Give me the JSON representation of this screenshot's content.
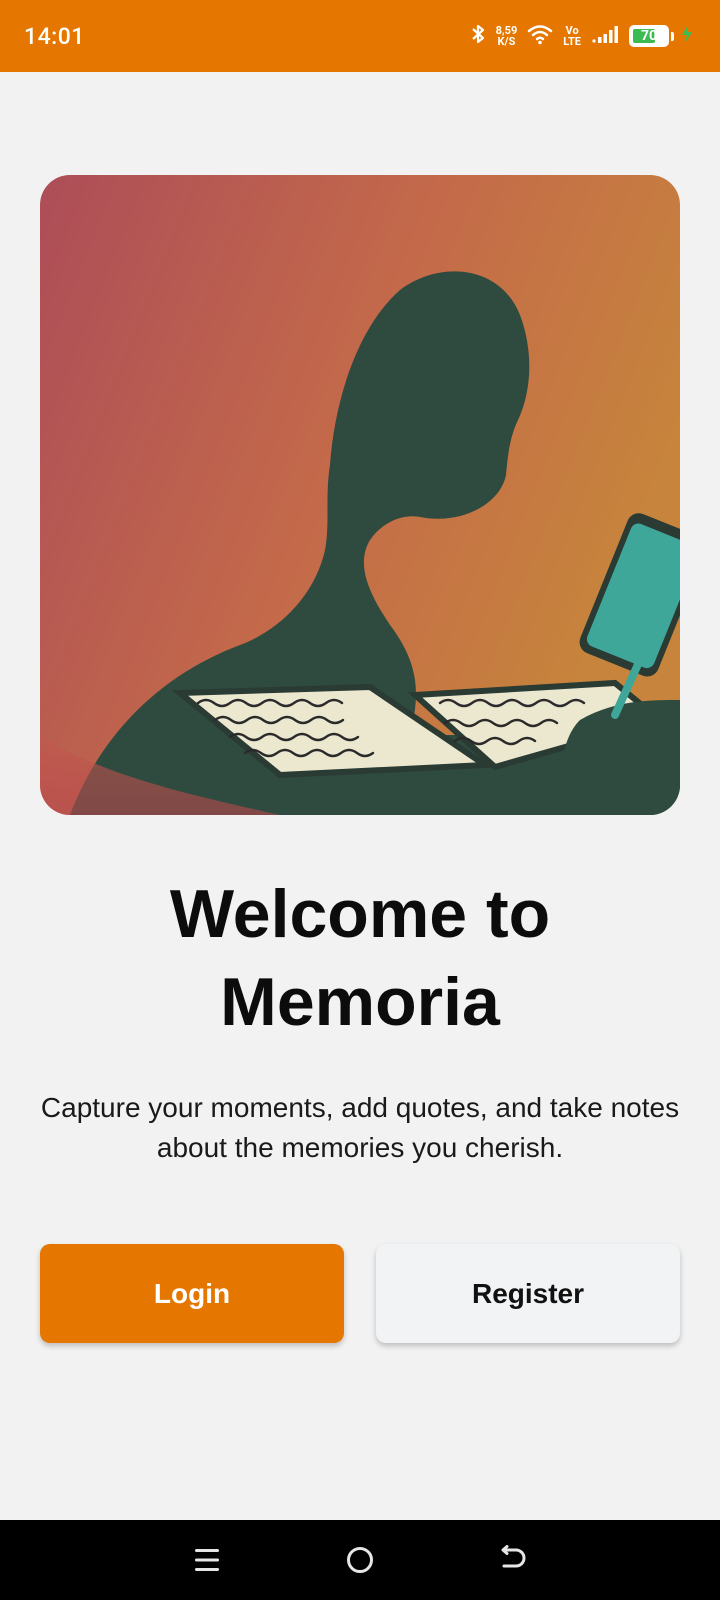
{
  "status_bar": {
    "time": "14:01",
    "net_speed_value": "8,59",
    "net_speed_unit": "K/S",
    "volte_top": "Vo",
    "volte_bottom": "LTE",
    "battery_level": "70",
    "battery_level_fraction": 0.7,
    "bg_color": "#e57700",
    "icons": [
      "bluetooth-icon",
      "wifi-icon",
      "signal-icon",
      "battery-icon",
      "charging-icon"
    ]
  },
  "hero": {
    "icon": "person-writing-journal-illustration"
  },
  "welcome": {
    "title_line1": "Welcome to",
    "title_line2": "Memoria",
    "subtitle": "Capture your moments, add quotes, and take notes about the memories you cherish."
  },
  "actions": {
    "login_label": "Login",
    "register_label": "Register",
    "accent_color": "#e57700"
  },
  "nav_bar": {
    "icons": [
      "menu-icon",
      "home-icon",
      "back-icon"
    ]
  }
}
